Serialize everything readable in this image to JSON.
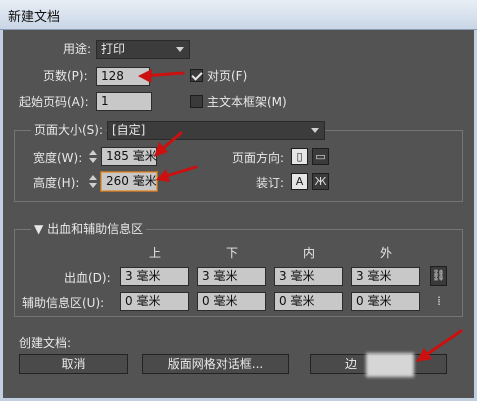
{
  "window": {
    "title": "新建文档"
  },
  "general": {
    "purpose_label": "用途:",
    "purpose_value": "打印",
    "pages_label": "页数(P):",
    "pages_value": "128",
    "facing_label": "对页(F)",
    "start_label": "起始页码(A):",
    "start_value": "1",
    "master_label": "主文本框架(M)"
  },
  "page_size": {
    "label": "页面大小(S):",
    "value": "[自定]",
    "width_label": "宽度(W):",
    "width_value": "185 毫米",
    "height_label": "高度(H):",
    "height_value": "260 毫米",
    "orientation_label": "页面方向:",
    "binding_label": "装订:"
  },
  "bleed": {
    "title": "出血和辅助信息区",
    "columns": [
      "上",
      "下",
      "内",
      "外"
    ],
    "bleed_label": "出血(D):",
    "bleed_values": [
      "3 毫米",
      "3 毫米",
      "3 毫米",
      "3 毫米"
    ],
    "slug_label": "辅助信息区(U):",
    "slug_values": [
      "0 毫米",
      "0 毫米",
      "0 毫米",
      "0 毫米"
    ]
  },
  "create": {
    "label": "创建文档:",
    "cancel": "取消",
    "grid_dialog": "版面网格对话框...",
    "margins": "边"
  },
  "colors": {
    "annotation_arrow": "#cc1010",
    "field_bg": "#c8c8c8",
    "dialog_bg": "#535353"
  },
  "icons": [
    "chevron-down-icon",
    "checkbox-icon",
    "stepper-icon",
    "portrait-icon",
    "landscape-icon",
    "binding-left-icon",
    "binding-right-icon",
    "chain-link-icon",
    "red-arrow-icon"
  ]
}
